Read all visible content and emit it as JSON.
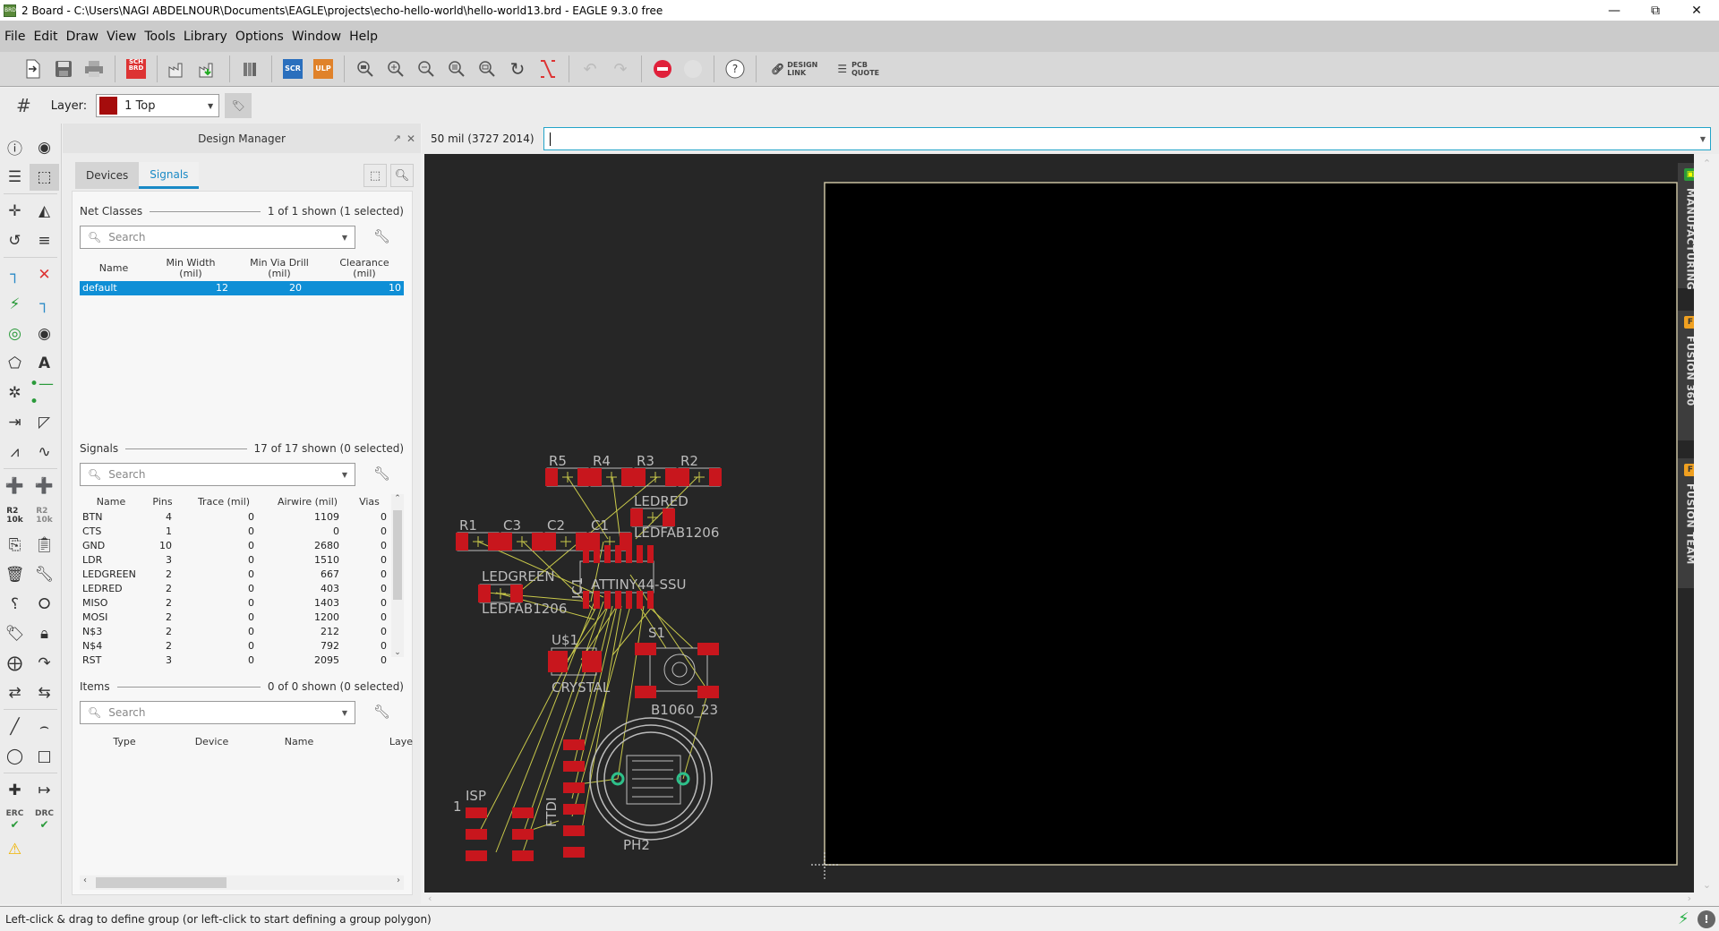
{
  "window": {
    "title": "2 Board - C:\\Users\\NAGI ABDELNOUR\\Documents\\EAGLE\\projects\\echo-hello-world\\hello-world13.brd - EAGLE 9.3.0 free",
    "controls": {
      "minimize": "—",
      "restore": "⧉",
      "close": "✕"
    }
  },
  "menu": [
    "File",
    "Edit",
    "Draw",
    "View",
    "Tools",
    "Library",
    "Options",
    "Window",
    "Help"
  ],
  "toolbar": {
    "buttons": [
      {
        "name": "new-icon",
        "glyph": "🗎"
      },
      {
        "name": "save-icon",
        "glyph": "💾"
      },
      {
        "name": "print-icon",
        "glyph": "🖨"
      },
      {
        "name": "sch-brd-icon",
        "label": "SCH BRD"
      },
      {
        "name": "cam-processor-icon",
        "glyph": "⚒"
      },
      {
        "name": "manufacturing-import-icon",
        "glyph": "⇩"
      },
      {
        "name": "library-icon",
        "glyph": "▥"
      },
      {
        "name": "script-icon",
        "label": "SCR"
      },
      {
        "name": "ulp-icon",
        "label": "ULP"
      },
      {
        "name": "zoom-fit-icon",
        "glyph": "⦿"
      },
      {
        "name": "zoom-in-icon",
        "glyph": "⊕"
      },
      {
        "name": "zoom-out-icon",
        "glyph": "⊖"
      },
      {
        "name": "zoom-last-icon",
        "glyph": "⊜"
      },
      {
        "name": "zoom-select-icon",
        "glyph": "⊚"
      },
      {
        "name": "redraw-icon",
        "glyph": "↻"
      },
      {
        "name": "ratsnest-icon",
        "glyph": "⨯"
      },
      {
        "name": "undo-icon",
        "glyph": "↶"
      },
      {
        "name": "redo-icon",
        "glyph": "↷"
      },
      {
        "name": "stop-icon",
        "glyph": "⊖"
      },
      {
        "name": "go-icon",
        "glyph": "●"
      },
      {
        "name": "help-icon",
        "glyph": "?"
      }
    ],
    "design_link": "DESIGN\nLINK",
    "design_link_1": "DESIGN",
    "design_link_2": "LINK",
    "pcb_quote_1": "PCB",
    "pcb_quote_2": "QUOTE"
  },
  "toolbar2": {
    "layer_label": "Layer:",
    "layer_value": "1 Top",
    "layer_color": "#a50c0c"
  },
  "design_manager": {
    "title": "Design Manager",
    "tabs": [
      "Devices",
      "Signals"
    ],
    "active_tab": "Signals",
    "net_classes": {
      "title": "Net Classes",
      "count": "1 of 1 shown (1 selected)",
      "search_placeholder": "Search",
      "columns": [
        "Name",
        "Min Width\n(mil)",
        "Min Via Drill\n(mil)",
        "Clearance\n(mil)"
      ],
      "col1": "Name",
      "col2a": "Min Width",
      "col2b": "(mil)",
      "col3a": "Min Via Drill",
      "col3b": "(mil)",
      "col4a": "Clearance",
      "col4b": "(mil)",
      "rows": [
        {
          "name": "default",
          "min_width": "12",
          "min_via_drill": "20",
          "clearance": "10",
          "selected": true
        }
      ]
    },
    "signals": {
      "title": "Signals",
      "count": "17 of 17 shown (0 selected)",
      "search_placeholder": "Search",
      "columns": [
        "Name",
        "Pins",
        "Trace (mil)",
        "Airwire (mil)",
        "Vias"
      ],
      "rows": [
        [
          "BTN",
          "4",
          "0",
          "1109",
          "0"
        ],
        [
          "CTS",
          "1",
          "0",
          "0",
          "0"
        ],
        [
          "GND",
          "10",
          "0",
          "2680",
          "0"
        ],
        [
          "LDR",
          "3",
          "0",
          "1510",
          "0"
        ],
        [
          "LEDGREEN",
          "2",
          "0",
          "667",
          "0"
        ],
        [
          "LEDRED",
          "2",
          "0",
          "403",
          "0"
        ],
        [
          "MISO",
          "2",
          "0",
          "1403",
          "0"
        ],
        [
          "MOSI",
          "2",
          "0",
          "1200",
          "0"
        ],
        [
          "N$3",
          "2",
          "0",
          "212",
          "0"
        ],
        [
          "N$4",
          "2",
          "0",
          "792",
          "0"
        ],
        [
          "RST",
          "3",
          "0",
          "2095",
          "0"
        ]
      ]
    },
    "items": {
      "title": "Items",
      "count": "0 of 0 shown (0 selected)",
      "search_placeholder": "Search",
      "columns": [
        "Type",
        "Device",
        "Name",
        "Laye"
      ]
    }
  },
  "canvas": {
    "coordinate_readout": "50 mil (3727 2014)",
    "command_value": "",
    "labels": {
      "r5": "R5",
      "r4": "R4",
      "r3": "R3",
      "r2": "R2",
      "r1": "R1",
      "c3": "C3",
      "c2": "C2",
      "c1": "C1",
      "ledred": "LEDRED",
      "ledred_pkg": "LEDFAB1206",
      "ledgreen": "LEDGREEN",
      "ledgreen_pkg": "LEDFAB1206",
      "attiny": "ATTINY44-SSU",
      "ic1": "IC1",
      "us1": "U$1",
      "crystal": "CRYSTAL",
      "s1": "S1",
      "b1060": "B1060_23",
      "isp": "ISP",
      "isp_pin": "1",
      "ftdi": "FTDI",
      "ph2": "PH2"
    },
    "colors": {
      "pad": "#c8161d",
      "airwire": "#c8c84a",
      "outline": "#c8c0a0",
      "silk": "#bcbcbc",
      "via": "#2ec08a"
    }
  },
  "side_panels": [
    {
      "label": "MANUFACTURING",
      "color": "#2a9a3a"
    },
    {
      "label": "FUSION 360",
      "color": "#f0a020"
    },
    {
      "label": "FUSION TEAM",
      "color": "#f0a020"
    }
  ],
  "statusbar": {
    "text": "Left-click & drag to define group (or left-click to start defining a group polygon)"
  }
}
